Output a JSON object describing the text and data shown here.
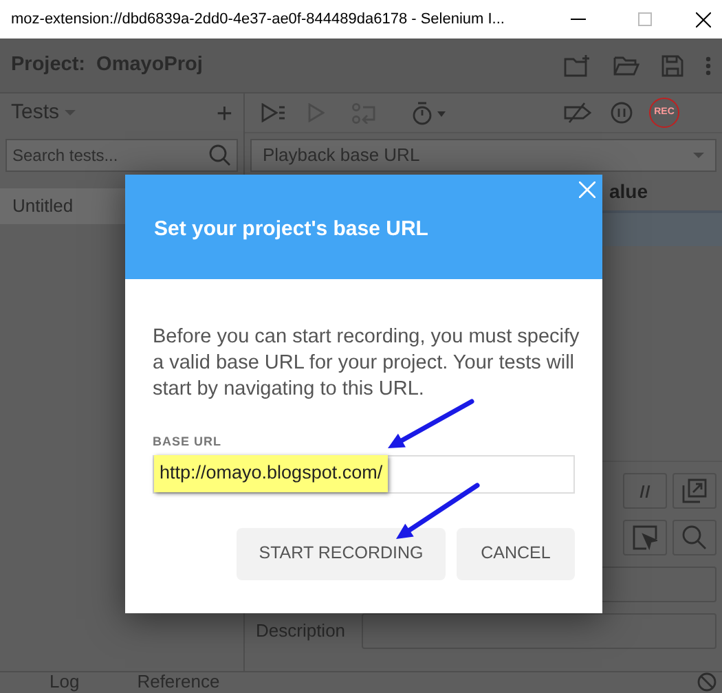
{
  "window": {
    "title": "moz-extension://dbd6839a-2dd0-4e37-ae0f-844489da6178 - Selenium I..."
  },
  "project": {
    "label": "Project:",
    "name": "OmayoProj"
  },
  "tests_panel": {
    "title": "Tests",
    "add": "+",
    "search": {
      "placeholder": "Search tests..."
    },
    "tests": [
      {
        "name": "Untitled",
        "selected": true
      }
    ]
  },
  "toolbar": {
    "record": "REC"
  },
  "playback": {
    "placeholder": "Playback base URL"
  },
  "table": {
    "column_2": "alue"
  },
  "description_label": "Description",
  "bottom_tabs": [
    {
      "label": "Log"
    },
    {
      "label": "Reference"
    }
  ],
  "dialog": {
    "title": "Set your project's base URL",
    "message": "Before you can start recording, you must specify a valid base URL for your project. Your tests will start by navigating to this URL.",
    "field_label": "BASE URL",
    "base_url": "http://omayo.blogspot.com/",
    "highlighted": true,
    "buttons": [
      {
        "label": "START RECORDING"
      },
      {
        "label": "CANCEL"
      }
    ]
  }
}
